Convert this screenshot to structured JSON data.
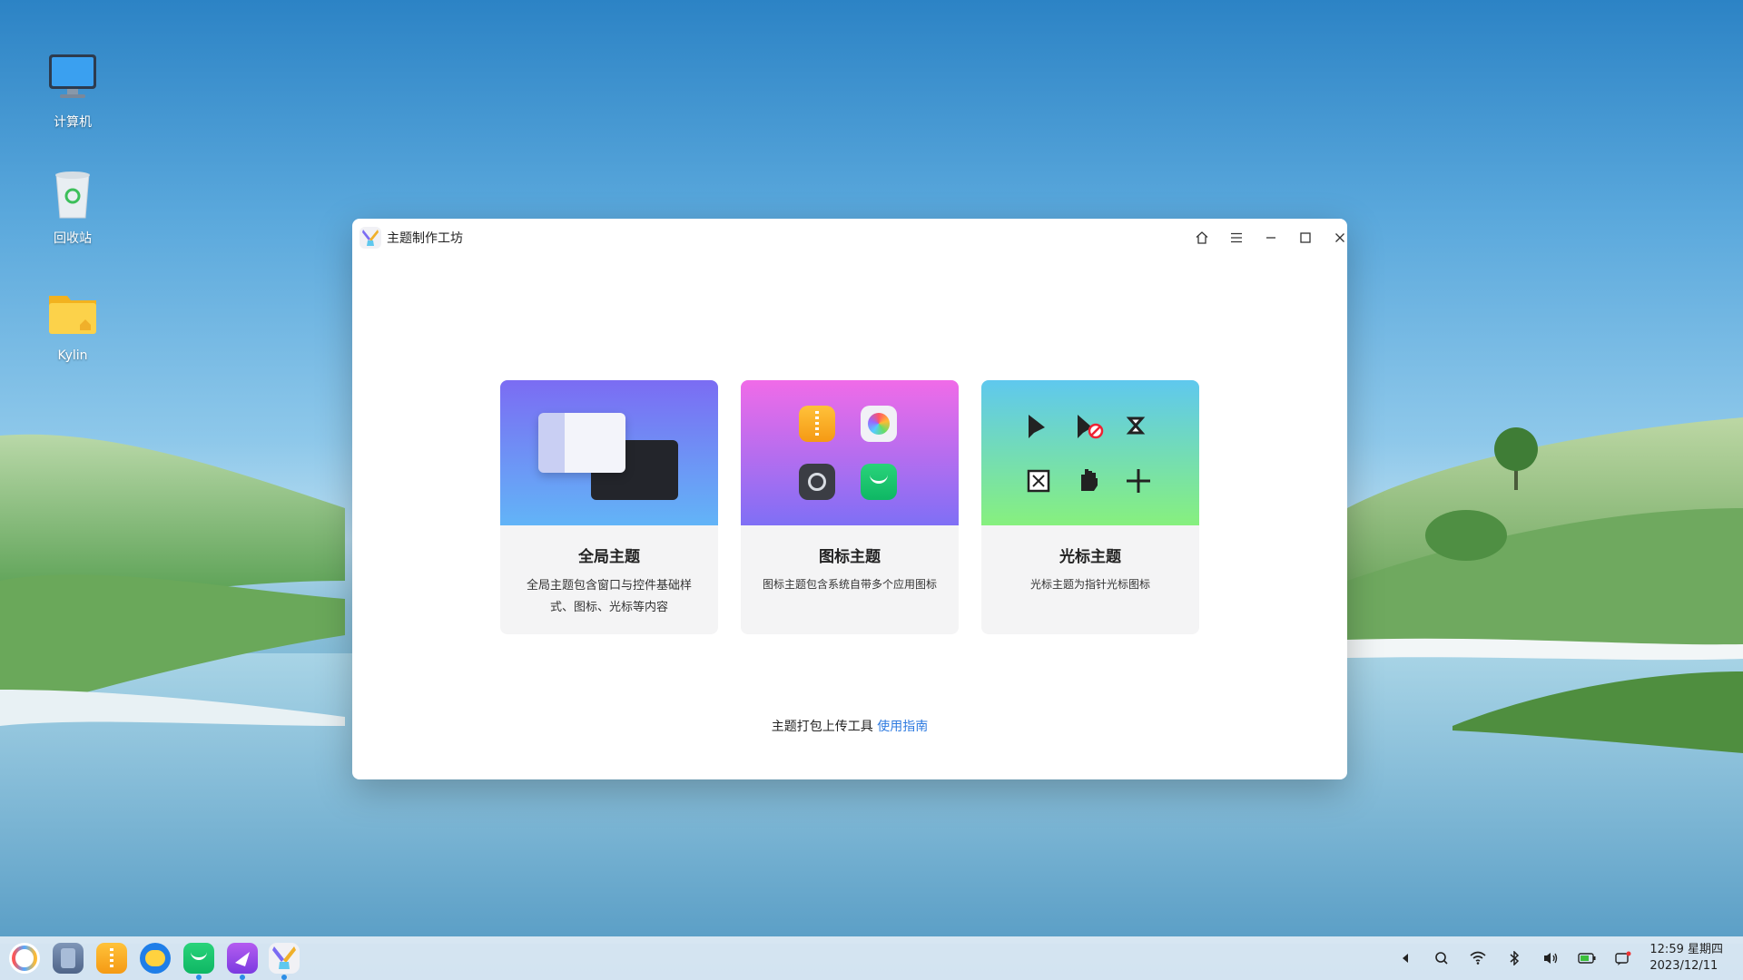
{
  "desktop": {
    "icons": [
      {
        "label": "计算机",
        "icon": "computer-icon"
      },
      {
        "label": "回收站",
        "icon": "trash-icon"
      },
      {
        "label": "Kylin",
        "icon": "folder-home-icon"
      }
    ]
  },
  "window": {
    "title": "主题制作工坊",
    "controls": [
      "home-icon",
      "menu-icon",
      "minimize-icon",
      "maximize-icon",
      "close-icon"
    ],
    "cards": [
      {
        "title": "全局主题",
        "desc": "全局主题包含窗口与控件基础样式、图标、光标等内容",
        "colors": [
          "#7b6cf3",
          "#62b4f7"
        ]
      },
      {
        "title": "图标主题",
        "desc": "图标主题包含系统自带多个应用图标",
        "colors": [
          "#f06be8",
          "#7f6ff5"
        ]
      },
      {
        "title": "光标主题",
        "desc": "光标主题为指针光标图标",
        "colors": [
          "#5fc8ee",
          "#87f07e"
        ]
      }
    ],
    "footer": {
      "text": "主题打包上传工具",
      "link": "使用指南"
    }
  },
  "taskbar": {
    "apps": [
      "start-menu-icon",
      "multitask-view-icon",
      "file-manager-icon",
      "browser-icon",
      "software-store-icon",
      "video-app-icon",
      "theme-workshop-icon"
    ],
    "tray": [
      "show-hidden-icon",
      "search-icon",
      "wifi-icon",
      "bluetooth-icon",
      "volume-icon",
      "battery-icon",
      "notification-icon"
    ],
    "time": "12:59 星期四",
    "date": "2023/12/11"
  },
  "colors": {
    "accent": "#2f7be0",
    "window_bg": "#ffffff",
    "card_bg": "#f4f4f5"
  }
}
